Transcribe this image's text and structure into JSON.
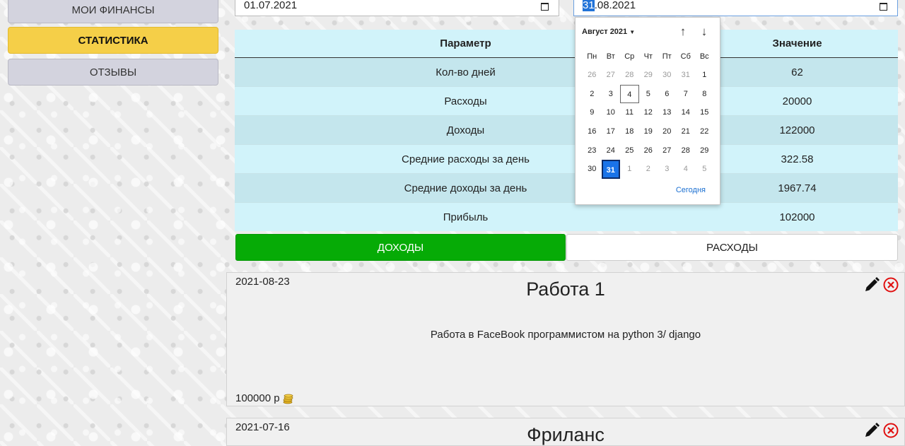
{
  "sidebar": {
    "items": [
      {
        "label": "МОИ ФИНАНСЫ"
      },
      {
        "label": "СТАТИСТИКА"
      },
      {
        "label": "ОТЗЫВЫ"
      }
    ]
  },
  "filters": {
    "date_from": "01.07.2021",
    "date_to_selected": "31",
    "date_to_rest": ".08.2021"
  },
  "stats": {
    "headers": [
      "Параметр",
      "Значение"
    ],
    "rows": [
      {
        "param": "Кол-во дней",
        "value": "62"
      },
      {
        "param": "Расходы",
        "value": "20000"
      },
      {
        "param": "Доходы",
        "value": "122000"
      },
      {
        "param": "Средние расходы за день",
        "value": "322.58"
      },
      {
        "param": "Средние доходы за день",
        "value": "1967.74"
      },
      {
        "param": "Прибыль",
        "value": "102000"
      }
    ]
  },
  "tabs": {
    "income": "ДОХОДЫ",
    "expenses": "РАСХОДЫ",
    "income_color": "#06ab06"
  },
  "entries": [
    {
      "date": "2021-08-23",
      "title": "Работа 1",
      "description": "Работа в FaceBook программистом на python 3/ django",
      "amount": "100000 р"
    },
    {
      "date": "2021-07-16",
      "title": "Фриланс"
    }
  ],
  "datepicker": {
    "month_label": "Август 2021",
    "weekdays": [
      "Пн",
      "Вт",
      "Ср",
      "Чт",
      "Пт",
      "Сб",
      "Вс"
    ],
    "days": [
      {
        "d": "26",
        "other": true
      },
      {
        "d": "27",
        "other": true
      },
      {
        "d": "28",
        "other": true
      },
      {
        "d": "29",
        "other": true
      },
      {
        "d": "30",
        "other": true
      },
      {
        "d": "31",
        "other": true
      },
      {
        "d": "1"
      },
      {
        "d": "2"
      },
      {
        "d": "3"
      },
      {
        "d": "4",
        "today": true
      },
      {
        "d": "5"
      },
      {
        "d": "6"
      },
      {
        "d": "7"
      },
      {
        "d": "8"
      },
      {
        "d": "9"
      },
      {
        "d": "10"
      },
      {
        "d": "11"
      },
      {
        "d": "12"
      },
      {
        "d": "13"
      },
      {
        "d": "14"
      },
      {
        "d": "15"
      },
      {
        "d": "16"
      },
      {
        "d": "17"
      },
      {
        "d": "18"
      },
      {
        "d": "19"
      },
      {
        "d": "20"
      },
      {
        "d": "21"
      },
      {
        "d": "22"
      },
      {
        "d": "23"
      },
      {
        "d": "24"
      },
      {
        "d": "25"
      },
      {
        "d": "26"
      },
      {
        "d": "27"
      },
      {
        "d": "28"
      },
      {
        "d": "29"
      },
      {
        "d": "30"
      },
      {
        "d": "31",
        "selected": true
      },
      {
        "d": "1",
        "other": true
      },
      {
        "d": "2",
        "other": true
      },
      {
        "d": "3",
        "other": true
      },
      {
        "d": "4",
        "other": true
      },
      {
        "d": "5",
        "other": true
      }
    ],
    "today_link": "Сегодня"
  },
  "icons": {
    "calendar": "calendar-icon",
    "edit": "pencil-icon",
    "delete": "close-circle-icon",
    "coins": "coins-icon"
  }
}
